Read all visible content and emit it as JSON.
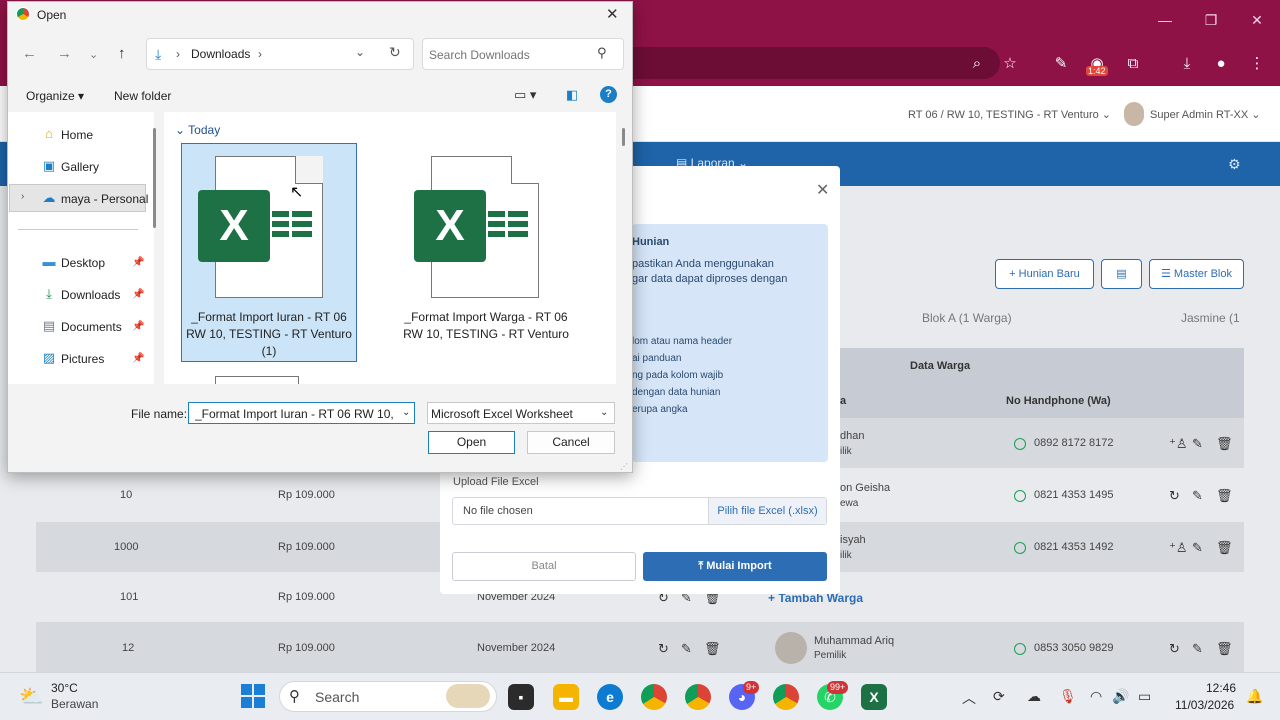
{
  "dialog": {
    "title": "Open",
    "path": "Downloads",
    "search_placeholder": "Search Downloads",
    "organize_label": "Organize",
    "new_folder_label": "New folder",
    "nav_items": [
      {
        "label": "Home"
      },
      {
        "label": "Gallery"
      },
      {
        "label": "maya - Personal"
      },
      {
        "label": "Desktop"
      },
      {
        "label": "Downloads"
      },
      {
        "label": "Documents"
      },
      {
        "label": "Pictures"
      }
    ],
    "group_label": "Today",
    "files": [
      {
        "name": "_Format Import Iuran - RT 06 RW 10, TESTING - RT Venturo (1)"
      },
      {
        "name": "_Format Import Warga - RT 06 RW 10, TESTING - RT Venturo"
      }
    ],
    "file_name_label": "File name:",
    "file_name_value": "_Format Import Iuran - RT 06 RW 10, T",
    "file_type": "Microsoft Excel Worksheet",
    "open_label": "Open",
    "cancel_label": "Cancel"
  },
  "browser": {
    "download_time_badge": "1:42"
  },
  "app": {
    "rt_selector": "RT 06 / RW 10, TESTING - RT Venturo",
    "admin_name": "Super Admin RT-XX",
    "nav_laporan": "Laporan",
    "buttons": {
      "hunian_baru": "+ Hunian Baru",
      "master_blok": "Master Blok"
    },
    "blok_tabs": [
      "Blok A (1 Warga)",
      "Jasmine (1"
    ],
    "table_title": "Data Warga",
    "col_name_partial": "a",
    "col_phone": "No Handphone (Wa)",
    "rows": [
      {
        "no": "",
        "amount": "",
        "month": "",
        "name": "dhan",
        "role": "ilik",
        "phone": "0892 8172 8172"
      },
      {
        "no": "10",
        "amount": "Rp 109.000",
        "month": "",
        "name": "on Geisha",
        "role": "ewa",
        "phone": "0821 4353 1495"
      },
      {
        "no": "1000",
        "amount": "Rp 109.000",
        "month": "",
        "name": "isyah",
        "role": "ilik",
        "phone": "0821 4353 1492"
      },
      {
        "no": "101",
        "amount": "Rp 109.000",
        "month": "November 2024",
        "name": "",
        "role": "",
        "phone": ""
      },
      {
        "no": "12",
        "amount": "Rp 109.000",
        "month": "November 2024",
        "name": "Muhammad Ariq",
        "role": "Pemilik",
        "phone": "0853 3050 9829"
      }
    ],
    "tambah_warga": "+ Tambah Warga"
  },
  "import_modal": {
    "info_title": "Hunian",
    "info_lines": [
      "pastikan Anda menggunakan",
      "gar data dapat diproses dengan",
      "lom atau nama header",
      "ai panduan",
      "ng pada kolom wajib",
      "dengan data hunian",
      "erupa angka"
    ],
    "upload_label": "Upload File Excel",
    "no_file": "No file chosen",
    "pick_file": "Pilih file Excel (.xlsx)",
    "cancel": "Batal",
    "start_import": "Mulai Import"
  },
  "taskbar": {
    "temperature": "30°C",
    "weather": "Berawan",
    "search_label": "Search",
    "discord_badge": "9+",
    "whatsapp_badge": "99+",
    "time": "12:46",
    "date": "11/03/2026"
  }
}
